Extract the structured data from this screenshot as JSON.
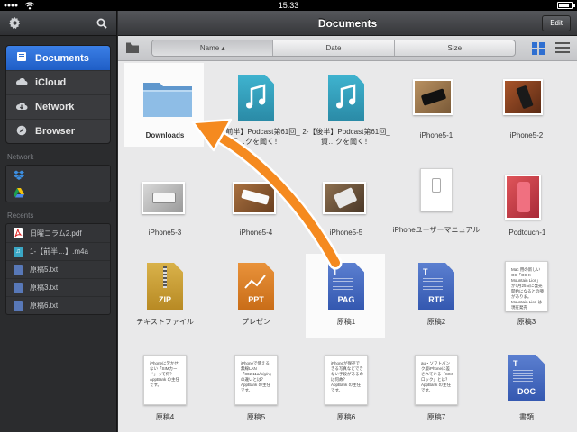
{
  "status": {
    "time": "15:33"
  },
  "sidebar": {
    "places": [
      {
        "label": "Documents",
        "icon": "documents-icon",
        "active": true
      },
      {
        "label": "iCloud",
        "icon": "cloud-icon"
      },
      {
        "label": "Network",
        "icon": "network-icon"
      },
      {
        "label": "Browser",
        "icon": "compass-icon"
      }
    ],
    "network_section": "Network",
    "recents_section": "Recents",
    "recents": [
      {
        "label": "日曜コラム2.pdf",
        "icon": "pdf-icon"
      },
      {
        "label": "1-【前半…】.m4a",
        "icon": "audio-icon"
      },
      {
        "label": "原稿5.txt",
        "icon": "text-file-icon"
      },
      {
        "label": "原稿3.txt",
        "icon": "text-file-icon"
      },
      {
        "label": "原稿6.txt",
        "icon": "text-file-icon"
      }
    ]
  },
  "header": {
    "title": "Documents",
    "edit_label": "Edit"
  },
  "sort": {
    "name": "Name ▴",
    "date": "Date",
    "size": "Size"
  },
  "files": {
    "downloads": "Downloads",
    "podcast1": "1-【前半】Podcast第61回_資…クを聞く！",
    "podcast2": "2-【後半】Podcast第61回_資…クを聞く！",
    "iphone5_1": "iPhone5-1",
    "iphone5_2": "iPhone5-2",
    "iphone5_3": "iPhone5-3",
    "iphone5_4": "iPhone5-4",
    "iphone5_5": "iPhone5-5",
    "manual": "iPhoneユーザーマニュアル",
    "ipodtouch": "iPodtouch-1",
    "zip": "テキストファイル",
    "ppt": "プレゼン",
    "pag": "原稿1",
    "rtf": "原稿2",
    "draft3": "原稿3",
    "draft4": "原稿4",
    "draft5": "原稿5",
    "draft6": "原稿6",
    "draft7": "原稿7",
    "doc": "書類"
  },
  "badges": {
    "zip": "ZIP",
    "ppt": "PPT",
    "pag": "PAG",
    "rtf": "RTF",
    "doc": "DOC"
  },
  "previews": {
    "draft3": "Mac 用の新しい OS「OS X Mountain Lion」が7月25日に発売開始になるとの噂がありま。Mountain Lion は現在発売",
    "draft4": "iPhoneに欠かせない「SIMカード」って何？ AppBank の主任です。",
    "draft5": "iPhoneで使える無線LAN「802.11a/b/g/n」の違いとは？ AppBank の主任です。",
    "draft6": "iPhoneが保存できる写真などできない手段があるのは何故？ AppBank の主任です。",
    "draft7": "au・ソフトバンク版iPhoneに差されている「SIMロック」とは？ AppBank の主任です。"
  },
  "colors": {
    "accent": "#2f6fd1",
    "arrow": "#f58a1f",
    "folder": "#7fb1e0"
  }
}
